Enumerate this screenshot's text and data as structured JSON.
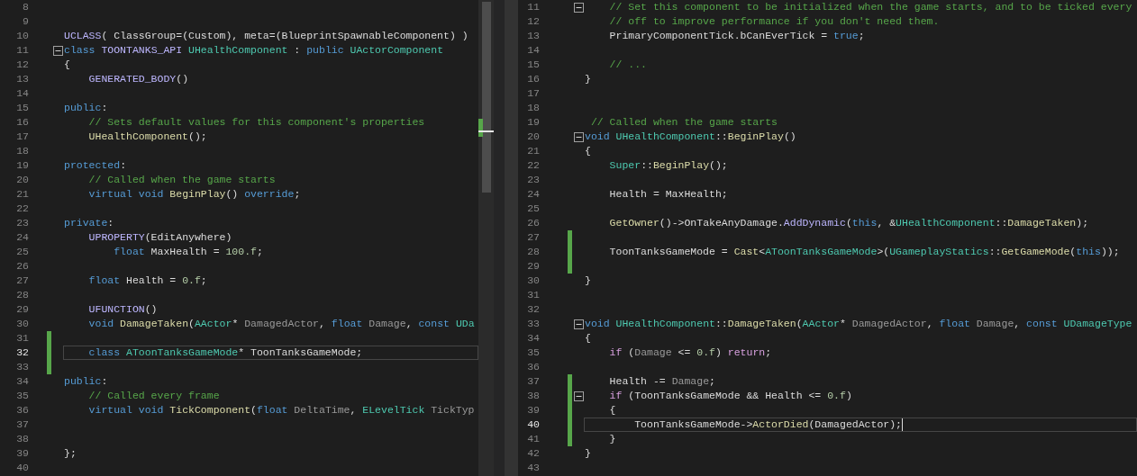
{
  "panes": [
    {
      "active": false,
      "lines": [
        {
          "number": "8",
          "changed": false,
          "current": false,
          "collapsible": false
        },
        {
          "number": "9",
          "changed": false,
          "current": false,
          "collapsible": false
        },
        {
          "number": "10",
          "changed": false,
          "current": false,
          "collapsible": false,
          "tokens": [
            {
              "text": "UCLASS",
              "kind": "macro"
            },
            {
              "text": "( ClassGroup=(Custom), meta=(BlueprintSpawnableComponent) )",
              "kind": "plain"
            }
          ]
        },
        {
          "number": "11",
          "changed": false,
          "current": false,
          "collapsible": true,
          "tokens": [
            {
              "text": "class",
              "kind": "keyword"
            },
            {
              "text": " TOONTANKS_API",
              "kind": "macro"
            },
            {
              "text": " UHealthComponent",
              "kind": "type"
            },
            {
              "text": " : ",
              "kind": "plain"
            },
            {
              "text": "public",
              "kind": "keyword"
            },
            {
              "text": " UActorComponent",
              "kind": "type"
            }
          ]
        },
        {
          "number": "12",
          "changed": false,
          "current": false,
          "collapsible": false,
          "tokens": [
            {
              "text": "{",
              "kind": "plain"
            }
          ]
        },
        {
          "number": "13",
          "changed": false,
          "current": false,
          "collapsible": false,
          "tokens": [
            {
              "text": "    GENERATED_BODY",
              "kind": "macro"
            },
            {
              "text": "()",
              "kind": "plain"
            }
          ]
        },
        {
          "number": "14",
          "changed": false,
          "current": false,
          "collapsible": false
        },
        {
          "number": "15",
          "changed": false,
          "current": false,
          "collapsible": false,
          "tokens": [
            {
              "text": "public",
              "kind": "keyword"
            },
            {
              "text": ":",
              "kind": "plain"
            }
          ]
        },
        {
          "number": "16",
          "changed": false,
          "current": false,
          "collapsible": false,
          "tokens": [
            {
              "text": "    // Sets default values for this component's properties",
              "kind": "comment"
            }
          ]
        },
        {
          "number": "17",
          "changed": false,
          "current": false,
          "collapsible": false,
          "tokens": [
            {
              "text": "    UHealthComponent",
              "kind": "function"
            },
            {
              "text": "();",
              "kind": "plain"
            }
          ]
        },
        {
          "number": "18",
          "changed": false,
          "current": false,
          "collapsible": false
        },
        {
          "number": "19",
          "changed": false,
          "current": false,
          "collapsible": false,
          "tokens": [
            {
              "text": "protected",
              "kind": "keyword"
            },
            {
              "text": ":",
              "kind": "plain"
            }
          ]
        },
        {
          "number": "20",
          "changed": false,
          "current": false,
          "collapsible": false,
          "tokens": [
            {
              "text": "    // Called when the game starts",
              "kind": "comment"
            }
          ]
        },
        {
          "number": "21",
          "changed": false,
          "current": false,
          "collapsible": false,
          "tokens": [
            {
              "text": "    virtual void",
              "kind": "keyword"
            },
            {
              "text": " BeginPlay",
              "kind": "function"
            },
            {
              "text": "() ",
              "kind": "plain"
            },
            {
              "text": "override",
              "kind": "keyword"
            },
            {
              "text": ";",
              "kind": "plain"
            }
          ]
        },
        {
          "number": "22",
          "changed": false,
          "current": false,
          "collapsible": false
        },
        {
          "number": "23",
          "changed": false,
          "current": false,
          "collapsible": false,
          "tokens": [
            {
              "text": "private",
              "kind": "keyword"
            },
            {
              "text": ":",
              "kind": "plain"
            }
          ]
        },
        {
          "number": "24",
          "changed": false,
          "current": false,
          "collapsible": false,
          "tokens": [
            {
              "text": "    UPROPERTY",
              "kind": "macro"
            },
            {
              "text": "(EditAnywhere)",
              "kind": "plain"
            }
          ]
        },
        {
          "number": "25",
          "changed": false,
          "current": false,
          "collapsible": false,
          "tokens": [
            {
              "text": "        float",
              "kind": "keyword"
            },
            {
              "text": " MaxHealth = ",
              "kind": "plain"
            },
            {
              "text": "100.f",
              "kind": "number"
            },
            {
              "text": ";",
              "kind": "plain"
            }
          ]
        },
        {
          "number": "26",
          "changed": false,
          "current": false,
          "collapsible": false
        },
        {
          "number": "27",
          "changed": false,
          "current": false,
          "collapsible": false,
          "tokens": [
            {
              "text": "    float",
              "kind": "keyword"
            },
            {
              "text": " Health = ",
              "kind": "plain"
            },
            {
              "text": "0.f",
              "kind": "number"
            },
            {
              "text": ";",
              "kind": "plain"
            }
          ]
        },
        {
          "number": "28",
          "changed": false,
          "current": false,
          "collapsible": false
        },
        {
          "number": "29",
          "changed": false,
          "current": false,
          "collapsible": false,
          "tokens": [
            {
              "text": "    UFUNCTION",
              "kind": "macro"
            },
            {
              "text": "()",
              "kind": "plain"
            }
          ]
        },
        {
          "number": "30",
          "changed": false,
          "current": false,
          "collapsible": false,
          "tokens": [
            {
              "text": "    void",
              "kind": "keyword"
            },
            {
              "text": " DamageTaken",
              "kind": "function"
            },
            {
              "text": "(",
              "kind": "plain"
            },
            {
              "text": "AActor",
              "kind": "type"
            },
            {
              "text": "* ",
              "kind": "plain"
            },
            {
              "text": "DamagedActor",
              "kind": "param"
            },
            {
              "text": ", ",
              "kind": "plain"
            },
            {
              "text": "float",
              "kind": "keyword"
            },
            {
              "text": " Damage",
              "kind": "param"
            },
            {
              "text": ", ",
              "kind": "plain"
            },
            {
              "text": "const",
              "kind": "keyword"
            },
            {
              "text": " UDa",
              "kind": "type"
            }
          ]
        },
        {
          "number": "31",
          "changed": true,
          "current": false,
          "collapsible": false
        },
        {
          "number": "32",
          "changed": true,
          "current": true,
          "collapsible": false,
          "tokens": [
            {
              "text": "    class",
              "kind": "keyword"
            },
            {
              "text": " AToonTanksGameMode",
              "kind": "type"
            },
            {
              "text": "* ToonTanksGameMode;",
              "kind": "plain"
            }
          ]
        },
        {
          "number": "33",
          "changed": true,
          "current": false,
          "collapsible": false
        },
        {
          "number": "34",
          "changed": false,
          "current": false,
          "collapsible": false,
          "tokens": [
            {
              "text": "public",
              "kind": "keyword"
            },
            {
              "text": ":",
              "kind": "plain"
            }
          ]
        },
        {
          "number": "35",
          "changed": false,
          "current": false,
          "collapsible": false,
          "tokens": [
            {
              "text": "    // Called every frame",
              "kind": "comment"
            }
          ]
        },
        {
          "number": "36",
          "changed": false,
          "current": false,
          "collapsible": false,
          "tokens": [
            {
              "text": "    virtual void",
              "kind": "keyword"
            },
            {
              "text": " TickComponent",
              "kind": "function"
            },
            {
              "text": "(",
              "kind": "plain"
            },
            {
              "text": "float",
              "kind": "keyword"
            },
            {
              "text": " DeltaTime",
              "kind": "param"
            },
            {
              "text": ", ",
              "kind": "plain"
            },
            {
              "text": "ELevelTick",
              "kind": "type"
            },
            {
              "text": " TickTyp",
              "kind": "param"
            }
          ]
        },
        {
          "number": "37",
          "changed": false,
          "current": false,
          "collapsible": false
        },
        {
          "number": "38",
          "changed": false,
          "current": false,
          "collapsible": false
        },
        {
          "number": "39",
          "changed": false,
          "current": false,
          "collapsible": false,
          "tokens": [
            {
              "text": "};",
              "kind": "plain"
            }
          ]
        },
        {
          "number": "40",
          "changed": false,
          "current": false,
          "collapsible": false
        }
      ]
    },
    {
      "active": true,
      "lines": [
        {
          "number": "11",
          "changed": false,
          "current": false,
          "collapsible": true,
          "tokens": [
            {
              "text": "    // Set this component to be initialized when the game starts, and to be ticked every",
              "kind": "comment"
            }
          ]
        },
        {
          "number": "12",
          "changed": false,
          "current": false,
          "collapsible": false,
          "tokens": [
            {
              "text": "    // off to improve performance if you don't need them.",
              "kind": "comment"
            }
          ]
        },
        {
          "number": "13",
          "changed": false,
          "current": false,
          "collapsible": false,
          "tokens": [
            {
              "text": "    PrimaryComponentTick.bCanEverTick = ",
              "kind": "plain"
            },
            {
              "text": "true",
              "kind": "keyword"
            },
            {
              "text": ";",
              "kind": "plain"
            }
          ]
        },
        {
          "number": "14",
          "changed": false,
          "current": false,
          "collapsible": false
        },
        {
          "number": "15",
          "changed": false,
          "current": false,
          "collapsible": false,
          "tokens": [
            {
              "text": "    // ...",
              "kind": "comment"
            }
          ]
        },
        {
          "number": "16",
          "changed": false,
          "current": false,
          "collapsible": false,
          "tokens": [
            {
              "text": "}",
              "kind": "plain"
            }
          ]
        },
        {
          "number": "17",
          "changed": false,
          "current": false,
          "collapsible": false
        },
        {
          "number": "18",
          "changed": false,
          "current": false,
          "collapsible": false
        },
        {
          "number": "19",
          "changed": false,
          "current": false,
          "collapsible": false,
          "tokens": [
            {
              "text": " // Called when the game starts",
              "kind": "comment"
            }
          ]
        },
        {
          "number": "20",
          "changed": false,
          "current": false,
          "collapsible": true,
          "tokens": [
            {
              "text": "void",
              "kind": "keyword"
            },
            {
              "text": " UHealthComponent",
              "kind": "type"
            },
            {
              "text": "::",
              "kind": "plain"
            },
            {
              "text": "BeginPlay",
              "kind": "function"
            },
            {
              "text": "()",
              "kind": "plain"
            }
          ]
        },
        {
          "number": "21",
          "changed": false,
          "current": false,
          "collapsible": false,
          "tokens": [
            {
              "text": "{",
              "kind": "plain"
            }
          ]
        },
        {
          "number": "22",
          "changed": false,
          "current": false,
          "collapsible": false,
          "tokens": [
            {
              "text": "    Super",
              "kind": "type"
            },
            {
              "text": "::",
              "kind": "plain"
            },
            {
              "text": "BeginPlay",
              "kind": "function"
            },
            {
              "text": "();",
              "kind": "plain"
            }
          ]
        },
        {
          "number": "23",
          "changed": false,
          "current": false,
          "collapsible": false
        },
        {
          "number": "24",
          "changed": false,
          "current": false,
          "collapsible": false,
          "tokens": [
            {
              "text": "    Health = MaxHealth;",
              "kind": "plain"
            }
          ]
        },
        {
          "number": "25",
          "changed": false,
          "current": false,
          "collapsible": false
        },
        {
          "number": "26",
          "changed": false,
          "current": false,
          "collapsible": false,
          "tokens": [
            {
              "text": "    GetOwner",
              "kind": "function"
            },
            {
              "text": "()->OnTakeAnyDamage.",
              "kind": "plain"
            },
            {
              "text": "AddDynamic",
              "kind": "macro"
            },
            {
              "text": "(",
              "kind": "plain"
            },
            {
              "text": "this",
              "kind": "keyword"
            },
            {
              "text": ", &",
              "kind": "plain"
            },
            {
              "text": "UHealthComponent",
              "kind": "type"
            },
            {
              "text": "::",
              "kind": "plain"
            },
            {
              "text": "DamageTaken",
              "kind": "function"
            },
            {
              "text": ");",
              "kind": "plain"
            }
          ]
        },
        {
          "number": "27",
          "changed": true,
          "current": false,
          "collapsible": false
        },
        {
          "number": "28",
          "changed": true,
          "current": false,
          "collapsible": false,
          "tokens": [
            {
              "text": "    ToonTanksGameMode = ",
              "kind": "plain"
            },
            {
              "text": "Cast",
              "kind": "function"
            },
            {
              "text": "<",
              "kind": "plain"
            },
            {
              "text": "AToonTanksGameMode",
              "kind": "type"
            },
            {
              "text": ">(",
              "kind": "plain"
            },
            {
              "text": "UGameplayStatics",
              "kind": "type"
            },
            {
              "text": "::",
              "kind": "plain"
            },
            {
              "text": "GetGameMode",
              "kind": "function"
            },
            {
              "text": "(",
              "kind": "plain"
            },
            {
              "text": "this",
              "kind": "keyword"
            },
            {
              "text": "));",
              "kind": "plain"
            }
          ]
        },
        {
          "number": "29",
          "changed": true,
          "current": false,
          "collapsible": false
        },
        {
          "number": "30",
          "changed": false,
          "current": false,
          "collapsible": false,
          "tokens": [
            {
              "text": "}",
              "kind": "plain"
            }
          ]
        },
        {
          "number": "31",
          "changed": false,
          "current": false,
          "collapsible": false
        },
        {
          "number": "32",
          "changed": false,
          "current": false,
          "collapsible": false
        },
        {
          "number": "33",
          "changed": false,
          "current": false,
          "collapsible": true,
          "tokens": [
            {
              "text": "void",
              "kind": "keyword"
            },
            {
              "text": " UHealthComponent",
              "kind": "type"
            },
            {
              "text": "::",
              "kind": "plain"
            },
            {
              "text": "DamageTaken",
              "kind": "function"
            },
            {
              "text": "(",
              "kind": "plain"
            },
            {
              "text": "AActor",
              "kind": "type"
            },
            {
              "text": "* ",
              "kind": "plain"
            },
            {
              "text": "DamagedActor",
              "kind": "param"
            },
            {
              "text": ", ",
              "kind": "plain"
            },
            {
              "text": "float",
              "kind": "keyword"
            },
            {
              "text": " Damage",
              "kind": "param"
            },
            {
              "text": ", ",
              "kind": "plain"
            },
            {
              "text": "const",
              "kind": "keyword"
            },
            {
              "text": " UDamageType",
              "kind": "type"
            }
          ]
        },
        {
          "number": "34",
          "changed": false,
          "current": false,
          "collapsible": false,
          "tokens": [
            {
              "text": "{",
              "kind": "plain"
            }
          ]
        },
        {
          "number": "35",
          "changed": false,
          "current": false,
          "collapsible": false,
          "tokens": [
            {
              "text": "    if",
              "kind": "control"
            },
            {
              "text": " (",
              "kind": "plain"
            },
            {
              "text": "Damage",
              "kind": "param"
            },
            {
              "text": " <= ",
              "kind": "plain"
            },
            {
              "text": "0.f",
              "kind": "number"
            },
            {
              "text": ") ",
              "kind": "plain"
            },
            {
              "text": "return",
              "kind": "control"
            },
            {
              "text": ";",
              "kind": "plain"
            }
          ]
        },
        {
          "number": "36",
          "changed": false,
          "current": false,
          "collapsible": false
        },
        {
          "number": "37",
          "changed": true,
          "current": false,
          "collapsible": false,
          "tokens": [
            {
              "text": "    Health -= ",
              "kind": "plain"
            },
            {
              "text": "Damage",
              "kind": "param"
            },
            {
              "text": ";",
              "kind": "plain"
            }
          ]
        },
        {
          "number": "38",
          "changed": true,
          "current": false,
          "collapsible": true,
          "tokens": [
            {
              "text": "    if",
              "kind": "control"
            },
            {
              "text": " (ToonTanksGameMode && Health <= ",
              "kind": "plain"
            },
            {
              "text": "0.f",
              "kind": "number"
            },
            {
              "text": ")",
              "kind": "plain"
            }
          ]
        },
        {
          "number": "39",
          "changed": true,
          "current": false,
          "collapsible": false,
          "tokens": [
            {
              "text": "    {",
              "kind": "plain"
            }
          ]
        },
        {
          "number": "40",
          "changed": true,
          "current": true,
          "collapsible": false,
          "tokens": [
            {
              "text": "        ToonTanksGameMode->",
              "kind": "plain"
            },
            {
              "text": "ActorDied",
              "kind": "function"
            },
            {
              "text": "(DamagedActor);",
              "kind": "plain"
            }
          ]
        },
        {
          "number": "41",
          "changed": true,
          "current": false,
          "collapsible": false,
          "tokens": [
            {
              "text": "    }",
              "kind": "plain"
            }
          ]
        },
        {
          "number": "42",
          "changed": false,
          "current": false,
          "collapsible": false,
          "tokens": [
            {
              "text": "}",
              "kind": "plain"
            }
          ]
        },
        {
          "number": "43",
          "changed": false,
          "current": false,
          "collapsible": false
        }
      ]
    }
  ]
}
